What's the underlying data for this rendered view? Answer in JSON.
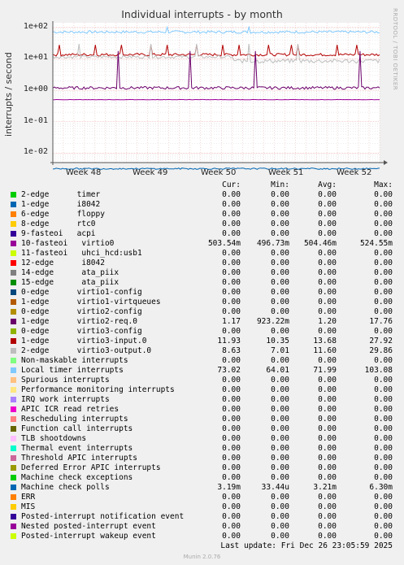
{
  "title": "Individual interrupts - by month",
  "side_credit": "RRDTOOL / TOBI OETIKER",
  "ylabel": "interrupts / second",
  "yticks": [
    "1e+02",
    "1e+01",
    "1e+00",
    "1e-01",
    "1e-02"
  ],
  "xticks": [
    "Week 48",
    "Week 49",
    "Week 50",
    "Week 51",
    "Week 52"
  ],
  "columns": [
    "Cur:",
    "Min:",
    "Avg:",
    "Max:"
  ],
  "colors": {
    "background": "#f0f0f0",
    "plot_bg": "#ffffff",
    "grid_major": "#e06060",
    "grid_minor": "#d0d0d0"
  },
  "legend": [
    {
      "label": "2-edge      timer",
      "color": "#00cc00",
      "cur": "0.00",
      "min": "0.00",
      "avg": "0.00",
      "max": "0.00"
    },
    {
      "label": "1-edge      i8042",
      "color": "#0066b3",
      "cur": "0.00",
      "min": "0.00",
      "avg": "0.00",
      "max": "0.00"
    },
    {
      "label": "6-edge      floppy",
      "color": "#ff8000",
      "cur": "0.00",
      "min": "0.00",
      "avg": "0.00",
      "max": "0.00"
    },
    {
      "label": "8-edge      rtc0",
      "color": "#ffcc00",
      "cur": "0.00",
      "min": "0.00",
      "avg": "0.00",
      "max": "0.00"
    },
    {
      "label": "9-fasteoi   acpi",
      "color": "#330099",
      "cur": "0.00",
      "min": "0.00",
      "avg": "0.00",
      "max": "0.00"
    },
    {
      "label": "10-fasteoi   virtio0",
      "color": "#990099",
      "cur": "503.54m",
      "min": "496.73m",
      "avg": "504.46m",
      "max": "524.55m"
    },
    {
      "label": "11-fasteoi   uhci_hcd:usb1",
      "color": "#ccff00",
      "cur": "0.00",
      "min": "0.00",
      "avg": "0.00",
      "max": "0.00"
    },
    {
      "label": "12-edge      i8042",
      "color": "#ff0000",
      "cur": "0.00",
      "min": "0.00",
      "avg": "0.00",
      "max": "0.00"
    },
    {
      "label": "14-edge      ata_piix",
      "color": "#808080",
      "cur": "0.00",
      "min": "0.00",
      "avg": "0.00",
      "max": "0.00"
    },
    {
      "label": "15-edge      ata_piix",
      "color": "#008f00",
      "cur": "0.00",
      "min": "0.00",
      "avg": "0.00",
      "max": "0.00"
    },
    {
      "label": "0-edge      virtio1-config",
      "color": "#00487d",
      "cur": "0.00",
      "min": "0.00",
      "avg": "0.00",
      "max": "0.00"
    },
    {
      "label": "1-edge      virtio1-virtqueues",
      "color": "#b35a00",
      "cur": "0.00",
      "min": "0.00",
      "avg": "0.00",
      "max": "0.00"
    },
    {
      "label": "0-edge      virtio2-config",
      "color": "#b38f00",
      "cur": "0.00",
      "min": "0.00",
      "avg": "0.00",
      "max": "0.00"
    },
    {
      "label": "1-edge      virtio2-req.0",
      "color": "#6b006b",
      "cur": "1.17",
      "min": "923.22m",
      "avg": "1.20",
      "max": "17.76"
    },
    {
      "label": "0-edge      virtio3-config",
      "color": "#8fb300",
      "cur": "0.00",
      "min": "0.00",
      "avg": "0.00",
      "max": "0.00"
    },
    {
      "label": "1-edge      virtio3-input.0",
      "color": "#b30000",
      "cur": "11.93",
      "min": "10.35",
      "avg": "13.68",
      "max": "27.92"
    },
    {
      "label": "2-edge      virtio3-output.0",
      "color": "#bebebe",
      "cur": "8.63",
      "min": "7.01",
      "avg": "11.60",
      "max": "29.86"
    },
    {
      "label": "Non-maskable interrupts",
      "color": "#80ff80",
      "cur": "0.00",
      "min": "0.00",
      "avg": "0.00",
      "max": "0.00"
    },
    {
      "label": "Local timer interrupts",
      "color": "#80c9ff",
      "cur": "73.02",
      "min": "64.01",
      "avg": "71.99",
      "max": "103.08"
    },
    {
      "label": "Spurious interrupts",
      "color": "#ffc080",
      "cur": "0.00",
      "min": "0.00",
      "avg": "0.00",
      "max": "0.00"
    },
    {
      "label": "Performance monitoring interrupts",
      "color": "#ffe680",
      "cur": "0.00",
      "min": "0.00",
      "avg": "0.00",
      "max": "0.00"
    },
    {
      "label": "IRQ work interrupts",
      "color": "#aa80ff",
      "cur": "0.00",
      "min": "0.00",
      "avg": "0.00",
      "max": "0.00"
    },
    {
      "label": "APIC ICR read retries",
      "color": "#ee00cc",
      "cur": "0.00",
      "min": "0.00",
      "avg": "0.00",
      "max": "0.00"
    },
    {
      "label": "Rescheduling interrupts",
      "color": "#ff8080",
      "cur": "0.00",
      "min": "0.00",
      "avg": "0.00",
      "max": "0.00"
    },
    {
      "label": "Function call interrupts",
      "color": "#666600",
      "cur": "0.00",
      "min": "0.00",
      "avg": "0.00",
      "max": "0.00"
    },
    {
      "label": "TLB shootdowns",
      "color": "#ffbfff",
      "cur": "0.00",
      "min": "0.00",
      "avg": "0.00",
      "max": "0.00"
    },
    {
      "label": "Thermal event interrupts",
      "color": "#00ffcc",
      "cur": "0.00",
      "min": "0.00",
      "avg": "0.00",
      "max": "0.00"
    },
    {
      "label": "Threshold APIC interrupts",
      "color": "#cc6699",
      "cur": "0.00",
      "min": "0.00",
      "avg": "0.00",
      "max": "0.00"
    },
    {
      "label": "Deferred Error APIC interrupts",
      "color": "#999900",
      "cur": "0.00",
      "min": "0.00",
      "avg": "0.00",
      "max": "0.00"
    },
    {
      "label": "Machine check exceptions",
      "color": "#00cc00",
      "cur": "0.00",
      "min": "0.00",
      "avg": "0.00",
      "max": "0.00"
    },
    {
      "label": "Machine check polls",
      "color": "#0066b3",
      "cur": "3.19m",
      "min": "33.44u",
      "avg": "3.21m",
      "max": "6.30m"
    },
    {
      "label": "ERR",
      "color": "#ff8000",
      "cur": "0.00",
      "min": "0.00",
      "avg": "0.00",
      "max": "0.00"
    },
    {
      "label": "MIS",
      "color": "#ffcc00",
      "cur": "0.00",
      "min": "0.00",
      "avg": "0.00",
      "max": "0.00"
    },
    {
      "label": "Posted-interrupt notification event",
      "color": "#330099",
      "cur": "0.00",
      "min": "0.00",
      "avg": "0.00",
      "max": "0.00"
    },
    {
      "label": "Nested posted-interrupt event",
      "color": "#990099",
      "cur": "0.00",
      "min": "0.00",
      "avg": "0.00",
      "max": "0.00"
    },
    {
      "label": "Posted-interrupt wakeup event",
      "color": "#ccff00",
      "cur": "0.00",
      "min": "0.00",
      "avg": "0.00",
      "max": "0.00"
    }
  ],
  "last_update": "Last update: Fri Dec 26 23:05:59 2025",
  "footer": "Munin 2.0.76",
  "chart_data": {
    "type": "line",
    "title": "Individual interrupts - by month",
    "ylabel": "interrupts / second",
    "yscale": "log",
    "ylim": [
      0.005,
      200
    ],
    "x_categories": [
      "Week 48",
      "Week 49",
      "Week 50",
      "Week 51",
      "Week 52"
    ],
    "series": [
      {
        "name": "Local timer interrupts",
        "color": "#80c9ff",
        "cur": 73.02,
        "min": 64.01,
        "avg": 71.99,
        "max": 103.08,
        "spike_positions": [
          0.35,
          0.6
        ]
      },
      {
        "name": "1-edge      virtio3-input.0",
        "color": "#b30000",
        "cur": 11.93,
        "min": 10.35,
        "avg": 13.68,
        "max": 27.92,
        "spike_positions": [
          0.02,
          0.13,
          0.21,
          0.3,
          0.35,
          0.44,
          0.52,
          0.57,
          0.66,
          0.73,
          0.75,
          0.87,
          0.93
        ]
      },
      {
        "name": "2-edge      virtio3-output.0",
        "color": "#bebebe",
        "cur": 8.63,
        "min": 7.01,
        "avg": 11.6,
        "max": 29.86,
        "spike_positions": [
          0.08,
          0.3,
          0.44,
          0.6,
          0.75
        ]
      },
      {
        "name": "1-edge      virtio2-req.0",
        "color": "#6b006b",
        "cur": 1.17,
        "min": 0.92322,
        "avg": 1.2,
        "max": 17.76,
        "spike_positions": [
          0.2,
          0.42,
          0.62,
          0.94
        ]
      },
      {
        "name": "10-fasteoi   virtio0",
        "color": "#990099",
        "cur": 0.50354,
        "min": 0.49673,
        "avg": 0.50446,
        "max": 0.52455,
        "spike_positions": []
      },
      {
        "name": "Machine check polls",
        "color": "#0066b3",
        "cur": 0.00319,
        "min": 3.344e-05,
        "avg": 0.00321,
        "max": 0.0063,
        "spike_positions": []
      }
    ]
  }
}
